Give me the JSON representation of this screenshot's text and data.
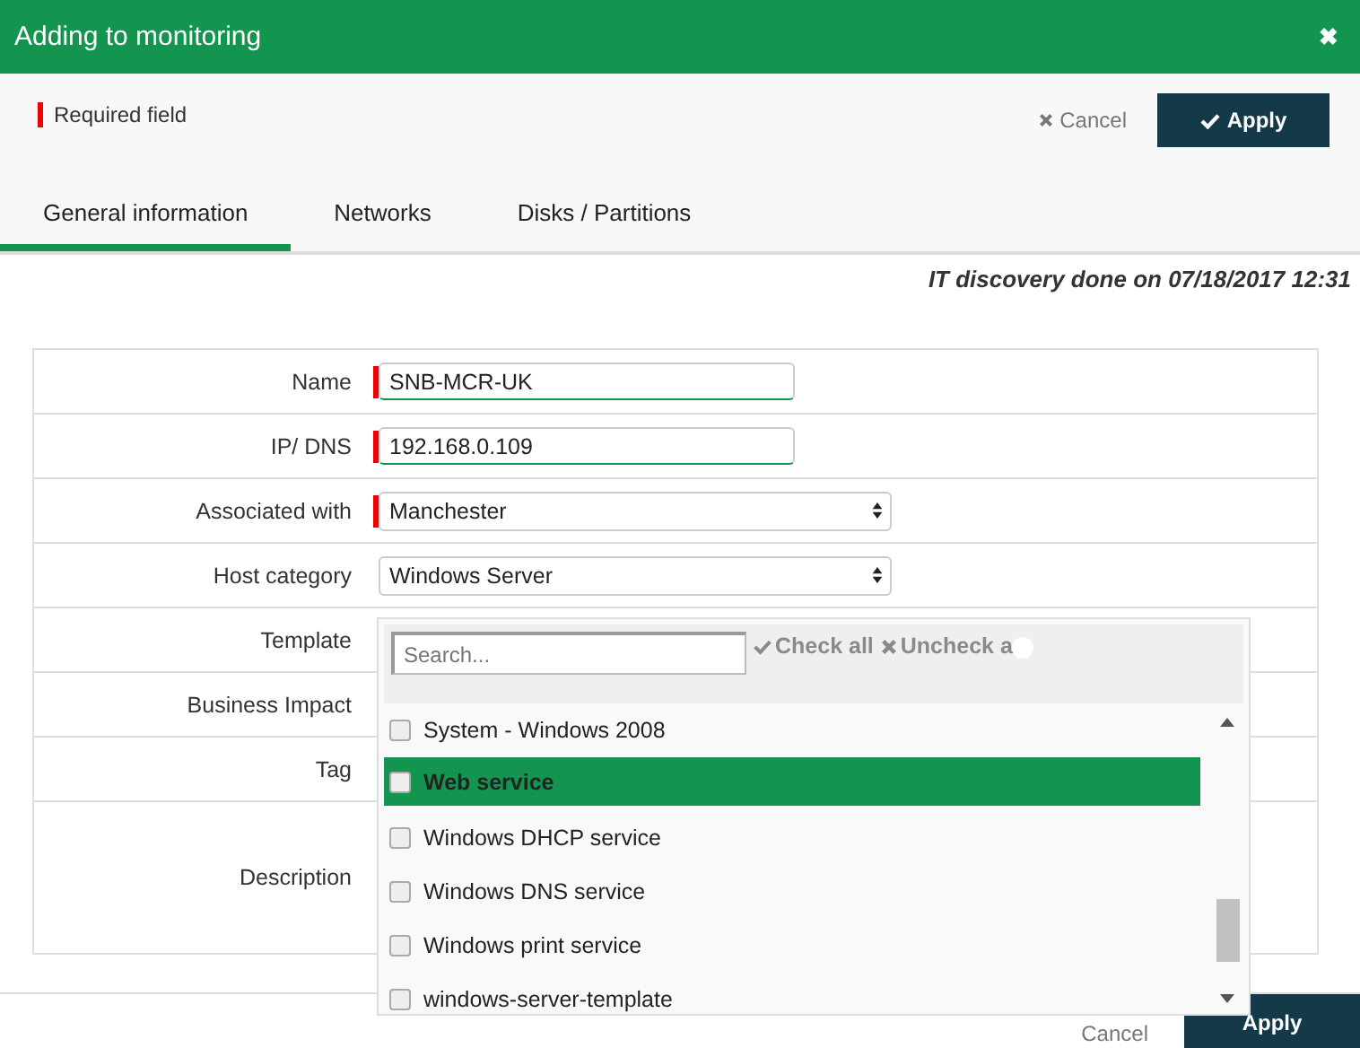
{
  "window": {
    "title": "Adding to monitoring",
    "close": "✖"
  },
  "legend": {
    "text": "Required field"
  },
  "toolbar": {
    "cancel": "Cancel",
    "apply": "Apply"
  },
  "tabs": [
    {
      "label": "General information",
      "selected": true
    },
    {
      "label": "Networks",
      "selected": false
    },
    {
      "label": "Disks / Partitions",
      "selected": false
    }
  ],
  "discovery": "IT discovery done on 07/18/2017 12:31",
  "form": [
    {
      "label": "Name",
      "kind": "text",
      "value": "SNB-MCR-UK",
      "required": true
    },
    {
      "label": "IP/ DNS",
      "kind": "text",
      "value": "192.168.0.109",
      "required": true
    },
    {
      "label": "Associated with",
      "kind": "select",
      "value": "Manchester",
      "required": true
    },
    {
      "label": "Host category",
      "kind": "select",
      "value": "Windows Server",
      "required": false
    },
    {
      "label": "Template",
      "kind": "empty",
      "required": false
    },
    {
      "label": "Business Impact",
      "kind": "empty",
      "required": false
    },
    {
      "label": "Tag",
      "kind": "empty",
      "required": false
    },
    {
      "label": "Description",
      "kind": "tall",
      "required": false
    }
  ],
  "dropdown": {
    "search_placeholder": "Search...",
    "check_all": "Check all",
    "uncheck_all": "Uncheck a",
    "items": [
      {
        "label": "System - Windows 2008",
        "checked": false,
        "selected": false
      },
      {
        "label": "Web service",
        "checked": false,
        "selected": true
      },
      {
        "label": "Windows DHCP service",
        "checked": false,
        "selected": false
      },
      {
        "label": "Windows DNS service",
        "checked": false,
        "selected": false
      },
      {
        "label": "Windows print service",
        "checked": false,
        "selected": false
      },
      {
        "label": "windows-server-template",
        "checked": false,
        "selected": false
      }
    ]
  },
  "footer": {
    "cancel": "Cancel",
    "apply": "Apply"
  }
}
